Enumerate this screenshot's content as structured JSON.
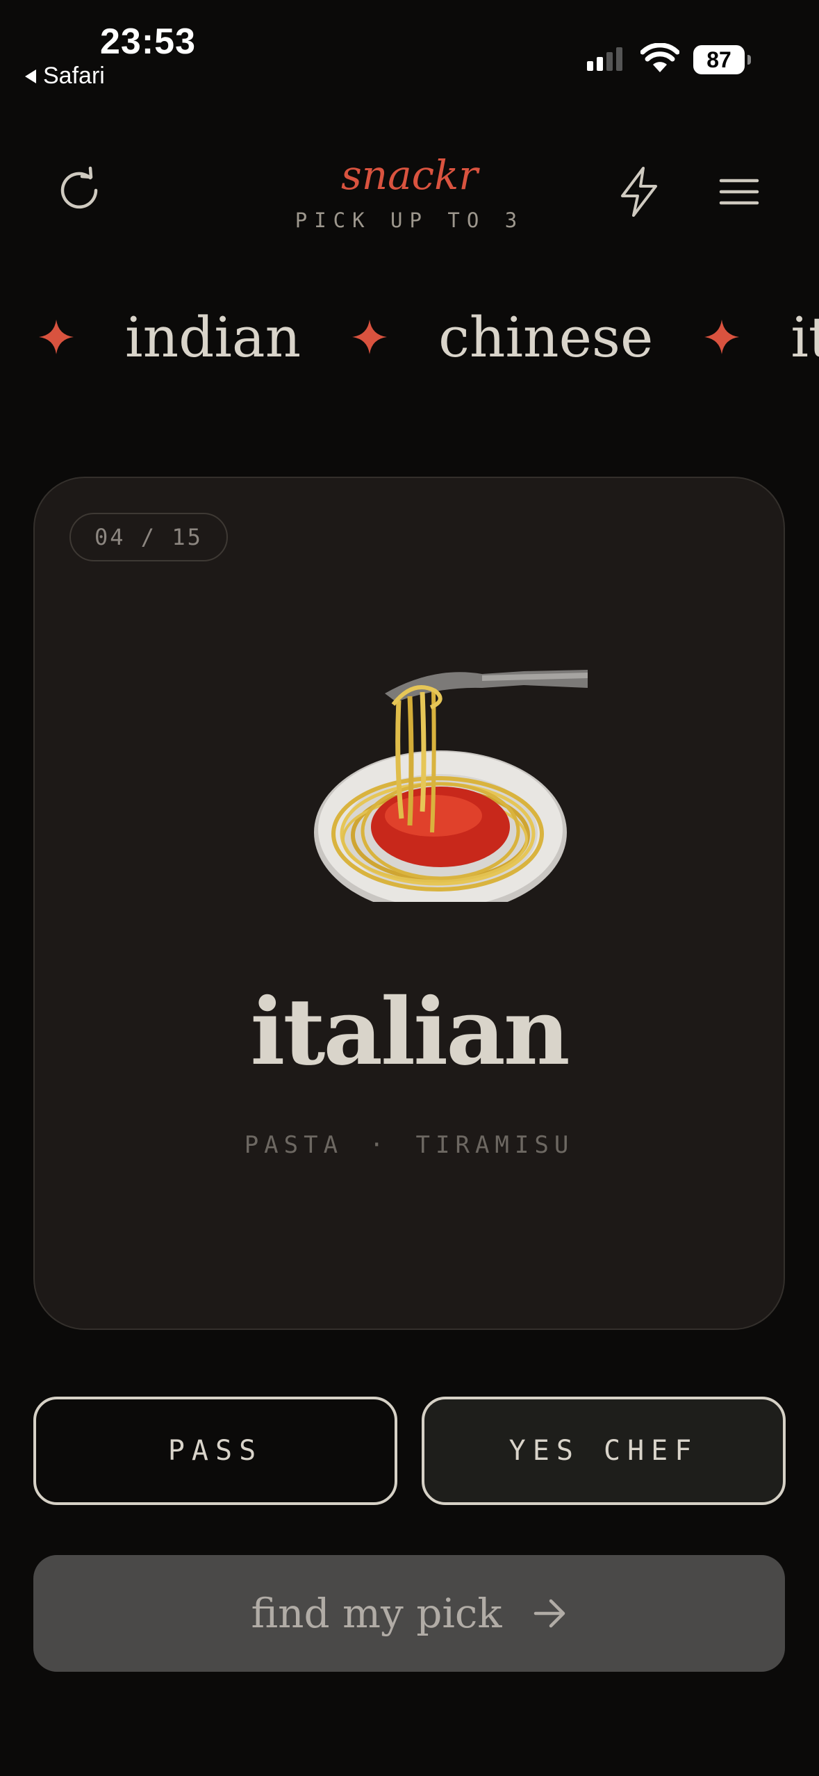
{
  "status_bar": {
    "time": "23:53",
    "back_app": "Safari",
    "battery": "87"
  },
  "header": {
    "logo": "snackr",
    "subtitle": "PICK UP TO 3",
    "icons": [
      "refresh-icon",
      "lightning-icon",
      "hamburger-menu-icon"
    ]
  },
  "marquee": {
    "items": [
      "indian",
      "chinese",
      "it"
    ]
  },
  "card": {
    "counter": "04 / 15",
    "image": "spaghetti-emoji",
    "cuisine": "italian",
    "dish1": "PASTA",
    "separator": "·",
    "dish2": "TIRAMISU"
  },
  "actions": {
    "pass": "PASS",
    "yes": "YES CHEF",
    "find": "find my pick"
  },
  "colors": {
    "background": "#0b0a09",
    "accent": "#d9533f",
    "card": "#1d1917",
    "text": "#d9d4ca"
  }
}
